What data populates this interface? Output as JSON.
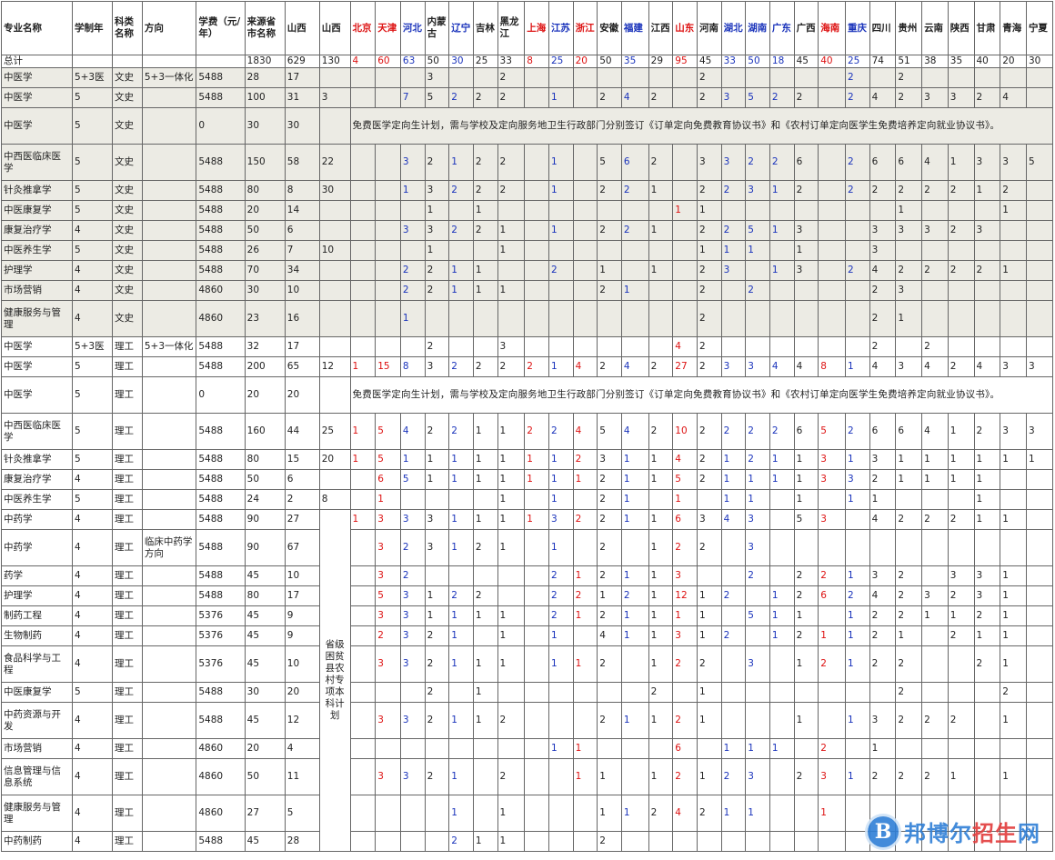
{
  "header": [
    "专业名称",
    "学制年",
    "科类名称",
    "方向",
    "学费（元/年）",
    "来源省市名称",
    "山西",
    "山西",
    "北京",
    "天津",
    "河北",
    "内蒙古",
    "辽宁",
    "吉林",
    "黑龙江",
    "上海",
    "江苏",
    "浙江",
    "安徽",
    "福建",
    "江西",
    "山东",
    "河南",
    "湖北",
    "湖南",
    "广东",
    "广西",
    "海南",
    "重庆",
    "四川",
    "贵州",
    "云南",
    "陕西",
    "甘肃",
    "青海",
    "宁夏"
  ],
  "header_colors": [
    "",
    "",
    "",
    "",
    "",
    "",
    "",
    "",
    "red",
    "red",
    "blue",
    "",
    "blue",
    "",
    "",
    "red",
    "blue",
    "red",
    "",
    "blue",
    "",
    "red",
    "",
    "blue",
    "blue",
    "blue",
    "",
    "red",
    "blue",
    "",
    "",
    "",
    "",
    "",
    "",
    ""
  ],
  "total_row": [
    "总计",
    "",
    "",
    "",
    "",
    "1830",
    "629",
    "130",
    "4",
    "60",
    "63",
    "50",
    "30",
    "25",
    "33",
    "8",
    "25",
    "20",
    "50",
    "35",
    "29",
    "95",
    "45",
    "33",
    "50",
    "18",
    "45",
    "40",
    "25",
    "74",
    "51",
    "38",
    "35",
    "40",
    "20",
    "30"
  ],
  "notice_text": "免费医学定向生计划，需与学校及定向服务地卫生行政部门分别签订《订单定向免费教育协议书》和《农村订单定向医学生免费培养定向就业协议书》。",
  "special_plan_label": "省级困贫县农村专项本科计划",
  "rows": [
    {
      "name": "中医学",
      "years": "5+3医",
      "cat": "文史",
      "dir": "5+3一体化",
      "fee": "5488",
      "total": "28",
      "sx1": "17",
      "sx2": "",
      "prov": [
        "",
        "",
        "",
        "3",
        "",
        "",
        "2",
        "",
        "",
        "",
        "",
        "",
        "",
        "",
        "2",
        "",
        "",
        "",
        "",
        "",
        "2",
        "",
        "2",
        "",
        "",
        "",
        ""
      ]
    },
    {
      "name": "中医学",
      "years": "5",
      "cat": "文史",
      "dir": "",
      "fee": "5488",
      "total": "100",
      "sx1": "31",
      "sx2": "3",
      "prov": [
        "",
        "",
        "7",
        "5",
        "2",
        "2",
        "2",
        "",
        "1",
        "",
        "2",
        "4",
        "2",
        "",
        "2",
        "3",
        "5",
        "2",
        "2",
        "",
        "2",
        "4",
        "2",
        "3",
        "3",
        "2",
        "4"
      ]
    },
    {
      "name": "中医学",
      "years": "5",
      "cat": "文史",
      "dir": "",
      "fee": "0",
      "total": "30",
      "sx1": "30",
      "sx2": "",
      "notice": true
    },
    {
      "name": "中西医临床医学",
      "years": "5",
      "cat": "文史",
      "dir": "",
      "fee": "5488",
      "total": "150",
      "sx1": "58",
      "sx2": "22",
      "prov": [
        "",
        "",
        "3",
        "2",
        "1",
        "2",
        "2",
        "",
        "1",
        "",
        "5",
        "6",
        "2",
        "",
        "3",
        "3",
        "2",
        "2",
        "6",
        "",
        "2",
        "6",
        "6",
        "4",
        "1",
        "3",
        "3",
        "5"
      ]
    },
    {
      "name": "针灸推拿学",
      "years": "5",
      "cat": "文史",
      "dir": "",
      "fee": "5488",
      "total": "80",
      "sx1": "8",
      "sx2": "30",
      "prov": [
        "",
        "",
        "1",
        "3",
        "2",
        "2",
        "2",
        "",
        "1",
        "",
        "2",
        "2",
        "1",
        "",
        "2",
        "2",
        "3",
        "1",
        "2",
        "",
        "2",
        "2",
        "2",
        "2",
        "2",
        "1",
        "2"
      ]
    },
    {
      "name": "中医康复学",
      "years": "5",
      "cat": "文史",
      "dir": "",
      "fee": "5488",
      "total": "20",
      "sx1": "14",
      "sx2": "",
      "prov": [
        "",
        "",
        "",
        "1",
        "",
        "1",
        "",
        "",
        "",
        "",
        "",
        "",
        "",
        "1",
        "1",
        "",
        "",
        "",
        "",
        "",
        "",
        "",
        "1",
        "",
        "",
        "",
        "1"
      ]
    },
    {
      "name": "康复治疗学",
      "years": "4",
      "cat": "文史",
      "dir": "",
      "fee": "5488",
      "total": "50",
      "sx1": "6",
      "sx2": "",
      "prov": [
        "",
        "",
        "3",
        "3",
        "2",
        "2",
        "1",
        "",
        "1",
        "",
        "2",
        "2",
        "1",
        "",
        "2",
        "2",
        "5",
        "1",
        "3",
        "",
        "",
        "3",
        "3",
        "3",
        "2",
        "3",
        ""
      ]
    },
    {
      "name": "中医养生学",
      "years": "5",
      "cat": "文史",
      "dir": "",
      "fee": "5488",
      "total": "26",
      "sx1": "7",
      "sx2": "10",
      "prov": [
        "",
        "",
        "",
        "1",
        "",
        "",
        "1",
        "",
        "",
        "",
        "",
        "",
        "",
        "",
        "1",
        "1",
        "1",
        "",
        "1",
        "",
        "",
        "3",
        "",
        "",
        "",
        "",
        ""
      ]
    },
    {
      "name": "护理学",
      "years": "4",
      "cat": "文史",
      "dir": "",
      "fee": "5488",
      "total": "70",
      "sx1": "34",
      "sx2": "",
      "prov": [
        "",
        "",
        "2",
        "2",
        "1",
        "1",
        "",
        "",
        "2",
        "",
        "1",
        "",
        "1",
        "",
        "2",
        "3",
        "",
        "1",
        "3",
        "",
        "2",
        "4",
        "2",
        "2",
        "2",
        "2",
        "1"
      ]
    },
    {
      "name": "市场营销",
      "years": "4",
      "cat": "文史",
      "dir": "",
      "fee": "4860",
      "total": "30",
      "sx1": "10",
      "sx2": "",
      "prov": [
        "",
        "",
        "2",
        "2",
        "1",
        "1",
        "1",
        "",
        "",
        "",
        "2",
        "1",
        "",
        "",
        "2",
        "",
        "2",
        "",
        "",
        "",
        "",
        "2",
        "3",
        "",
        "",
        "",
        ""
      ]
    },
    {
      "name": "健康服务与管理",
      "years": "4",
      "cat": "文史",
      "dir": "",
      "fee": "4860",
      "total": "23",
      "sx1": "16",
      "sx2": "",
      "prov": [
        "",
        "",
        "1",
        "",
        "",
        "",
        "",
        "",
        "",
        "",
        "",
        "",
        "",
        "",
        "2",
        "",
        "",
        "",
        "",
        "",
        "",
        "2",
        "1",
        "",
        "",
        "",
        ""
      ]
    },
    {
      "name": "中医学",
      "years": "5+3医",
      "cat": "理工",
      "dir": "5+3一体化",
      "fee": "5488",
      "total": "32",
      "sx1": "17",
      "sx2": "",
      "prov": [
        "",
        "",
        "",
        "2",
        "",
        "",
        "3",
        "",
        "",
        "",
        "",
        "",
        "",
        "4",
        "2",
        "",
        "",
        "",
        "",
        "",
        "",
        "2",
        "",
        "2",
        "",
        "",
        ""
      ]
    },
    {
      "name": "中医学",
      "years": "5",
      "cat": "理工",
      "dir": "",
      "fee": "5488",
      "total": "200",
      "sx1": "65",
      "sx2": "12",
      "prov": [
        "1",
        "15",
        "8",
        "3",
        "2",
        "2",
        "2",
        "2",
        "1",
        "4",
        "2",
        "4",
        "2",
        "27",
        "2",
        "3",
        "3",
        "4",
        "4",
        "8",
        "1",
        "4",
        "3",
        "4",
        "2",
        "4",
        "3",
        "3"
      ]
    },
    {
      "name": "中医学",
      "years": "5",
      "cat": "理工",
      "dir": "",
      "fee": "0",
      "total": "20",
      "sx1": "20",
      "sx2": "",
      "notice": true
    },
    {
      "name": "中西医临床医学",
      "years": "5",
      "cat": "理工",
      "dir": "",
      "fee": "5488",
      "total": "160",
      "sx1": "44",
      "sx2": "25",
      "prov": [
        "1",
        "5",
        "4",
        "2",
        "2",
        "1",
        "1",
        "2",
        "2",
        "4",
        "5",
        "4",
        "2",
        "10",
        "2",
        "2",
        "2",
        "2",
        "6",
        "5",
        "2",
        "6",
        "6",
        "4",
        "1",
        "2",
        "3",
        "3"
      ]
    },
    {
      "name": "针灸推拿学",
      "years": "5",
      "cat": "理工",
      "dir": "",
      "fee": "5488",
      "total": "80",
      "sx1": "15",
      "sx2": "20",
      "prov": [
        "1",
        "5",
        "1",
        "1",
        "1",
        "1",
        "1",
        "1",
        "1",
        "2",
        "3",
        "1",
        "1",
        "4",
        "2",
        "1",
        "2",
        "1",
        "1",
        "3",
        "1",
        "3",
        "1",
        "1",
        "1",
        "1",
        "1",
        "1"
      ]
    },
    {
      "name": "康复治疗学",
      "years": "4",
      "cat": "理工",
      "dir": "",
      "fee": "5488",
      "total": "50",
      "sx1": "6",
      "sx2": "",
      "prov": [
        "",
        "6",
        "5",
        "1",
        "1",
        "1",
        "1",
        "1",
        "1",
        "1",
        "2",
        "1",
        "1",
        "5",
        "2",
        "1",
        "1",
        "1",
        "1",
        "3",
        "3",
        "2",
        "1",
        "1",
        "1",
        "1",
        ""
      ]
    },
    {
      "name": "中医养生学",
      "years": "5",
      "cat": "理工",
      "dir": "",
      "fee": "5488",
      "total": "24",
      "sx1": "2",
      "sx2": "8",
      "prov": [
        "",
        "1",
        "",
        "",
        "",
        "",
        "1",
        "",
        "1",
        "",
        "2",
        "1",
        "",
        "1",
        "",
        "1",
        "1",
        "",
        "1",
        "",
        "1",
        "1",
        "",
        "",
        "",
        "1",
        ""
      ]
    },
    {
      "name": "中药学",
      "years": "4",
      "cat": "理工",
      "dir": "",
      "fee": "5488",
      "total": "90",
      "sx1": "27",
      "sx2": "",
      "prov": [
        "1",
        "3",
        "3",
        "3",
        "1",
        "1",
        "1",
        "1",
        "3",
        "2",
        "2",
        "1",
        "1",
        "6",
        "3",
        "4",
        "3",
        "",
        "5",
        "3",
        "",
        "4",
        "2",
        "2",
        "2",
        "1",
        "1"
      ]
    },
    {
      "name": "中药学",
      "years": "4",
      "cat": "理工",
      "dir": "临床中药学方向",
      "fee": "5488",
      "total": "90",
      "sx1": "67",
      "sx2": "",
      "prov": [
        "",
        "3",
        "2",
        "3",
        "1",
        "2",
        "1",
        "",
        "1",
        "",
        "2",
        "",
        "1",
        "2",
        "2",
        "",
        "3",
        "",
        "",
        "",
        "",
        "",
        "",
        "",
        "",
        "",
        ""
      ]
    },
    {
      "name": "药学",
      "years": "4",
      "cat": "理工",
      "dir": "",
      "fee": "5488",
      "total": "45",
      "sx1": "10",
      "sx2": "",
      "prov": [
        "",
        "3",
        "2",
        "",
        "",
        "",
        "",
        "",
        "2",
        "1",
        "2",
        "1",
        "1",
        "3",
        "",
        "",
        "2",
        "",
        "2",
        "2",
        "1",
        "3",
        "2",
        "",
        "3",
        "3",
        "1"
      ]
    },
    {
      "name": "护理学",
      "years": "4",
      "cat": "理工",
      "dir": "",
      "fee": "5488",
      "total": "80",
      "sx1": "17",
      "sx2": "",
      "prov": [
        "",
        "5",
        "3",
        "1",
        "2",
        "2",
        "",
        "",
        "2",
        "2",
        "1",
        "2",
        "1",
        "12",
        "1",
        "2",
        "",
        "1",
        "2",
        "6",
        "2",
        "4",
        "2",
        "3",
        "2",
        "3",
        "1"
      ]
    },
    {
      "name": "制药工程",
      "years": "4",
      "cat": "理工",
      "dir": "",
      "fee": "5376",
      "total": "45",
      "sx1": "9",
      "sx2": "",
      "prov": [
        "",
        "3",
        "3",
        "1",
        "1",
        "1",
        "1",
        "",
        "2",
        "1",
        "2",
        "1",
        "1",
        "1",
        "1",
        "",
        "5",
        "1",
        "1",
        "",
        "1",
        "2",
        "2",
        "1",
        "1",
        "2",
        "1"
      ]
    },
    {
      "name": "生物制药",
      "years": "4",
      "cat": "理工",
      "dir": "",
      "fee": "5376",
      "total": "45",
      "sx1": "9",
      "sx2": "",
      "prov": [
        "",
        "2",
        "3",
        "2",
        "1",
        "",
        "1",
        "",
        "1",
        "",
        "4",
        "1",
        "1",
        "3",
        "1",
        "2",
        "",
        "1",
        "2",
        "1",
        "1",
        "2",
        "1",
        "",
        "2",
        "1",
        "1"
      ]
    },
    {
      "name": "食品科学与工程",
      "years": "4",
      "cat": "理工",
      "dir": "",
      "fee": "5376",
      "total": "45",
      "sx1": "10",
      "sx2": "",
      "prov": [
        "",
        "3",
        "3",
        "2",
        "1",
        "1",
        "1",
        "",
        "1",
        "1",
        "2",
        "",
        "1",
        "2",
        "2",
        "",
        "3",
        "",
        "1",
        "2",
        "1",
        "2",
        "2",
        "",
        "",
        "2",
        "1"
      ]
    },
    {
      "name": "中医康复学",
      "years": "5",
      "cat": "理工",
      "dir": "",
      "fee": "5488",
      "total": "30",
      "sx1": "20",
      "sx2": "",
      "prov": [
        "",
        "",
        "",
        "2",
        "",
        "1",
        "",
        "",
        "",
        "",
        "",
        "",
        "2",
        "",
        "1",
        "",
        "",
        "",
        "",
        "",
        "",
        "",
        "2",
        "",
        "",
        "",
        "2"
      ]
    },
    {
      "name": "中药资源与开发",
      "years": "4",
      "cat": "理工",
      "dir": "",
      "fee": "5488",
      "total": "45",
      "sx1": "12",
      "sx2": "",
      "prov": [
        "",
        "3",
        "3",
        "2",
        "1",
        "1",
        "2",
        "",
        "",
        "",
        "2",
        "1",
        "1",
        "2",
        "1",
        "",
        "",
        "",
        "1",
        "",
        "1",
        "3",
        "2",
        "2",
        "2",
        "",
        "1"
      ]
    },
    {
      "name": "市场营销",
      "years": "4",
      "cat": "理工",
      "dir": "",
      "fee": "4860",
      "total": "20",
      "sx1": "4",
      "sx2": "",
      "prov": [
        "",
        "",
        "",
        "",
        "",
        "",
        "",
        "",
        "1",
        "1",
        "",
        "",
        "",
        "6",
        "",
        "1",
        "1",
        "1",
        "",
        "2",
        "",
        "1",
        "",
        "",
        "",
        "",
        ""
      ]
    },
    {
      "name": "信息管理与信息系统",
      "years": "4",
      "cat": "理工",
      "dir": "",
      "fee": "4860",
      "total": "50",
      "sx1": "11",
      "sx2": "",
      "prov": [
        "",
        "3",
        "3",
        "2",
        "1",
        "",
        "2",
        "",
        "",
        "1",
        "1",
        "",
        "1",
        "2",
        "1",
        "2",
        "3",
        "",
        "2",
        "3",
        "1",
        "2",
        "2",
        "2",
        "1",
        "",
        "1"
      ]
    },
    {
      "name": "健康服务与管理",
      "years": "4",
      "cat": "理工",
      "dir": "",
      "fee": "4860",
      "total": "27",
      "sx1": "5",
      "sx2": "",
      "prov": [
        "",
        "",
        "",
        "",
        "1",
        "",
        "1",
        "",
        "",
        "",
        "1",
        "1",
        "2",
        "4",
        "2",
        "1",
        "1",
        "",
        "",
        "1",
        "",
        "",
        "",
        "",
        "",
        "",
        ""
      ]
    },
    {
      "name": "中药制药",
      "years": "4",
      "cat": "理工",
      "dir": "",
      "fee": "5488",
      "total": "45",
      "sx1": "28",
      "sx2": "",
      "prov": [
        "",
        "",
        "",
        "",
        "2",
        "1",
        "1",
        "",
        "",
        "",
        "2",
        "",
        "",
        "",
        "",
        "",
        "",
        "",
        "",
        "",
        "",
        "",
        "",
        "",
        "",
        "",
        ""
      ]
    }
  ],
  "watermark": {
    "logo_letter": "B",
    "site_name": "邦博尔招生网",
    "emphasis": "招生"
  }
}
